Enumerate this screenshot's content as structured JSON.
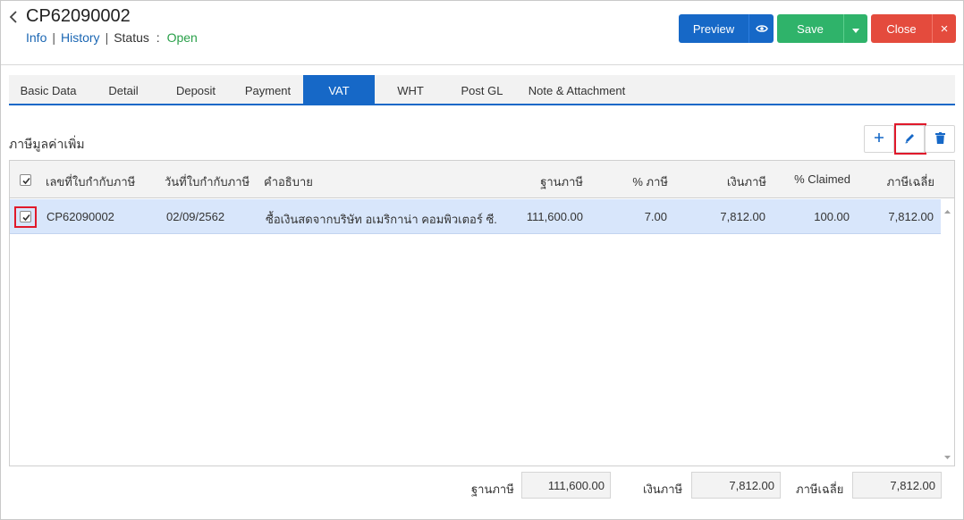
{
  "header": {
    "doc_no": "CP62090002",
    "info": "Info",
    "history": "History",
    "sep": "|",
    "status_label": "Status",
    "status_colon": ":",
    "status_value": "Open"
  },
  "buttons": {
    "preview": "Preview",
    "save": "Save",
    "close": "Close",
    "close_x": "×"
  },
  "tabs": [
    "Basic Data",
    "Detail",
    "Deposit",
    "Payment",
    "VAT",
    "WHT",
    "Post GL",
    "Note & Attachment"
  ],
  "active_tab": "VAT",
  "section": {
    "title": "ภาษีมูลค่าเพิ่ม"
  },
  "table": {
    "columns": [
      "เลขที่ใบกำกับภาษี",
      "วันที่ใบกำกับภาษี",
      "คำอธิบาย",
      "ฐานภาษี",
      "% ภาษี",
      "เงินภาษี",
      "% Claimed",
      "ภาษีเฉลี่ย"
    ],
    "rows": [
      {
        "tax_invoice_no": "CP62090002",
        "tax_invoice_date": "02/09/2562",
        "description": "ซื้อเงินสดจากบริษัท อเมริกาน่า คอมพิวเตอร์ ซี...",
        "tax_base": "111,600.00",
        "tax_pct": "7.00",
        "tax_amount": "7,812.00",
        "claimed_pct": "100.00",
        "avg_tax": "7,812.00",
        "checked": true
      }
    ]
  },
  "footer": {
    "tax_base_label": "ฐานภาษี",
    "tax_base_value": "111,600.00",
    "tax_amount_label": "เงินภาษี",
    "tax_amount_value": "7,812.00",
    "avg_tax_label": "ภาษีเฉลี่ย",
    "avg_tax_value": "7,812.00"
  },
  "colors": {
    "primary": "#1668c7",
    "success": "#2fb36a",
    "danger": "#e44b3d",
    "highlight": "#e0192b",
    "row_selected": "#d8e6fb"
  }
}
